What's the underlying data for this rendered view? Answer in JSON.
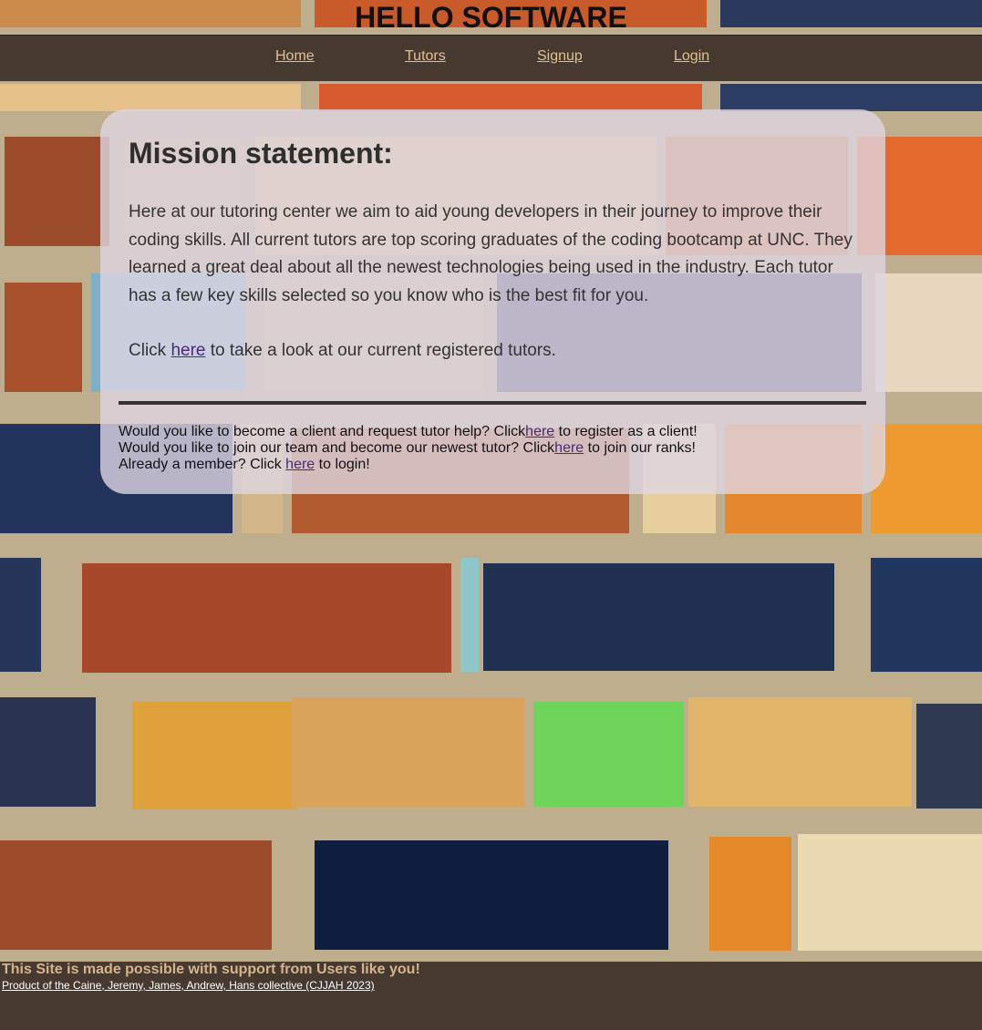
{
  "site": {
    "title": "HELLO SOFTWARE"
  },
  "nav": {
    "items": [
      {
        "label": "Home"
      },
      {
        "label": "Tutors"
      },
      {
        "label": "Signup"
      },
      {
        "label": "Login"
      }
    ]
  },
  "mission": {
    "heading": "Mission statement:",
    "body": "Here at our tutoring center we aim to aid young developers in their journey to improve their coding skills. All current tutors are top scoring graduates of the coding bootcamp at UNC. They learned a great deal about all the newest technologies being used in the industry. Each tutor has a few key skills selected so you know who is the best fit for you.",
    "click_prefix": "Click ",
    "click_link": "here",
    "click_suffix": " to take a look at our current registered tutors."
  },
  "members": {
    "client_prefix": "Would you like to become a client and request tutor help? Click",
    "client_link": "here",
    "client_suffix": " to register as a client!",
    "tutor_prefix": "Would you like to join our team and become our newest tutor? Click",
    "tutor_link": "here",
    "tutor_suffix": " to join our ranks!",
    "login_prefix": "Already a member? Click ",
    "login_link": "here",
    "login_suffix": " to login!"
  },
  "footer": {
    "support": "This Site is made possible with support from Users like you!",
    "credit": "Product of the Caine, Jeremy, James, Andrew, Hans collective (CJJAH 2023)"
  },
  "colors": {
    "nav_bg": "#463a30",
    "nav_link": "#e3bf8d",
    "footer_support": "#d5b48b",
    "card_bg": "rgba(222,214,226,0.80)",
    "link_visited": "#4a2a7a"
  }
}
